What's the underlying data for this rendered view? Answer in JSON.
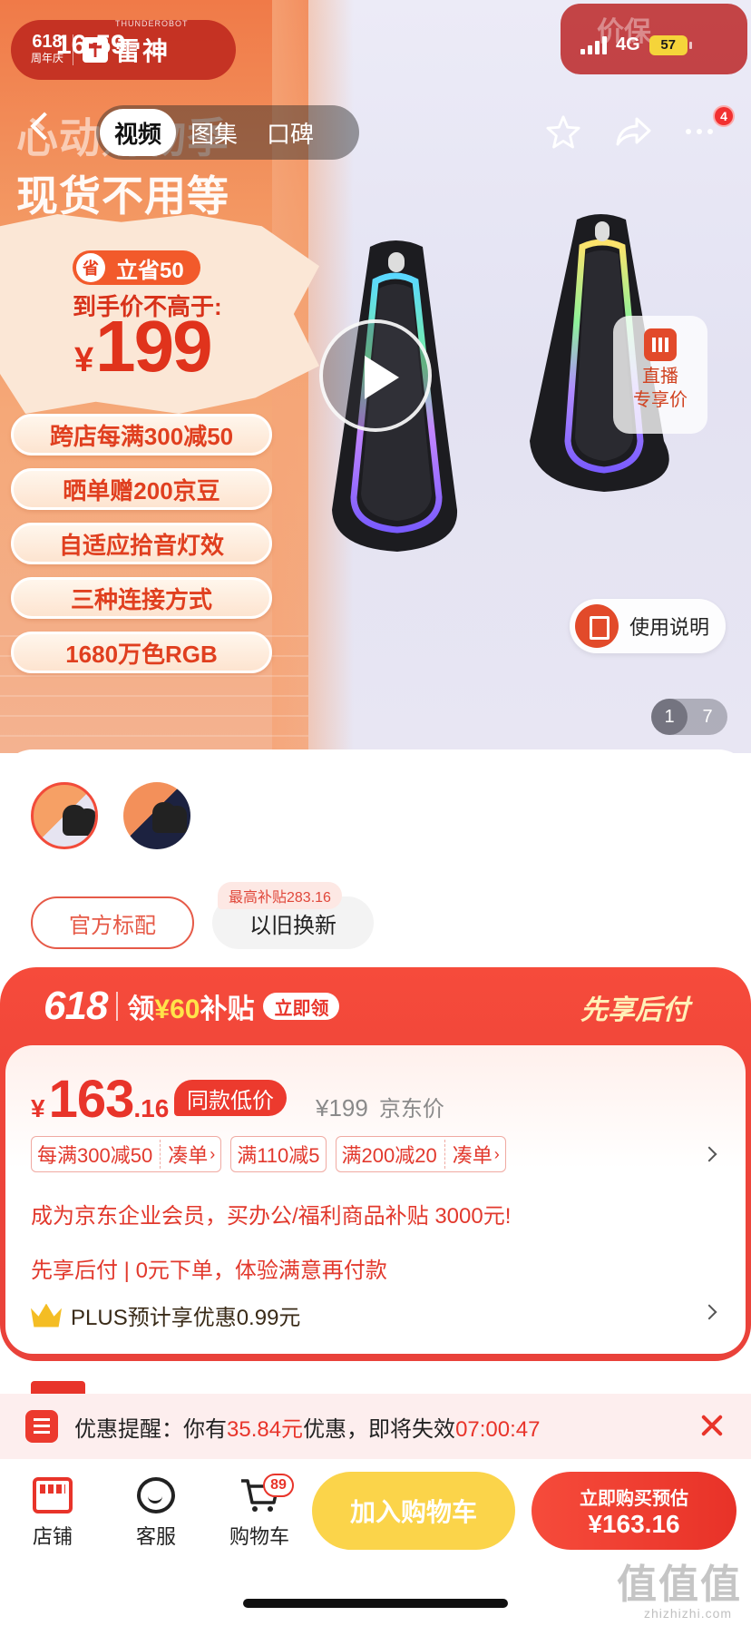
{
  "status_bar": {
    "time": "16:59",
    "network": "4G",
    "battery": "57"
  },
  "brand": {
    "badge_618": "618",
    "badge_sub": "周年庆",
    "name_en": "THUNDEROBOT",
    "name": "雷神"
  },
  "price_guard": "价保",
  "media_tabs": [
    {
      "label": "视频",
      "active": true
    },
    {
      "label": "图集",
      "active": false
    },
    {
      "label": "口碑",
      "active": false
    }
  ],
  "hero": {
    "title_line1": "心动购物季",
    "title_line2": "现货不用等",
    "save_icon_text": "省",
    "save_badge": "立省50",
    "hand_price_label": "到手价不高于:",
    "hand_price_symbol": "¥",
    "hand_price": "199",
    "features": [
      "跨店每满300减50",
      "晒单赠200京豆",
      "自适应拾音灯效",
      "三种连接方式",
      "1680万色RGB"
    ],
    "live_card": {
      "line1": "直播",
      "line2": "专享价"
    },
    "manual_label": "使用说明",
    "pager_current": "1",
    "pager_total": "7"
  },
  "header_actions": {
    "more_badge": "4"
  },
  "options": {
    "official": "官方标配",
    "tradein": "以旧换新",
    "tradein_tag": "最高补贴283.16"
  },
  "promo": {
    "tag_618": "618",
    "claim_prefix": "领",
    "claim_amount": "¥60",
    "claim_suffix": "补贴",
    "claim_button": "立即领",
    "pay_later": "先享后付"
  },
  "price": {
    "symbol": "¥",
    "integer": "163",
    "decimal": ".16",
    "low_tag": "同款低价",
    "original": "¥199",
    "original_label": "京东价"
  },
  "coupons": [
    {
      "text": "每满300减50",
      "action": "凑单"
    },
    {
      "text": "满110减5",
      "action": ""
    },
    {
      "text": "满200减20",
      "action": "凑单"
    }
  ],
  "enterprise_text": "成为京东企业会员，买办公/福利商品补贴 3000元!",
  "pay_later_text": "先享后付 | 0元下单，体验满意再付款",
  "plus": {
    "prefix": "PLUS预计享优惠",
    "amount": "0.99元"
  },
  "reminder": {
    "prefix": "优惠提醒：你有",
    "amount": "35.84元",
    "middle": "优惠，即将失效",
    "countdown": "07:00:47"
  },
  "bottom_bar": {
    "shop": "店铺",
    "service": "客服",
    "cart": "购物车",
    "cart_badge": "89",
    "add_cart": "加入购物车",
    "buy_line1": "立即购买预估",
    "buy_line2": "¥163.16"
  },
  "watermark": {
    "main": "值值值",
    "sub": "zhizhizhi.com"
  }
}
